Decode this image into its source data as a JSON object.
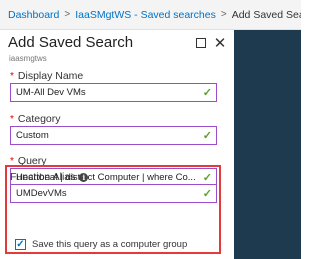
{
  "breadcrumb": {
    "items": [
      "Dashboard",
      "IaaSMgtWS - Saved searches",
      "Add Saved Search"
    ],
    "separator": ">"
  },
  "panel": {
    "title": "Add Saved Search",
    "subtitle": "iaasmgtws",
    "maximize_icon": "maximize-icon",
    "close_icon": "close-icon"
  },
  "form": {
    "display_name": {
      "label": "Display Name",
      "required_mark": "*",
      "value": "UM-All Dev VMs"
    },
    "category": {
      "label": "Category",
      "required_mark": "*",
      "value": "Custom"
    },
    "query": {
      "label": "Query",
      "required_mark": "*",
      "value": "Heartbeat | distinct Computer | where Co..."
    },
    "function_alias": {
      "label": "Function Alias",
      "info_glyph": "i",
      "value": "UMDevVMs"
    },
    "computer_group": {
      "label": "Save this query as a computer group",
      "checked": true
    }
  },
  "glyphs": {
    "check": "✓",
    "close": "✕"
  },
  "colors": {
    "link": "#0072c6",
    "input_border": "#9b4dca",
    "valid_check": "#5aa02c",
    "highlight": "#e23b3b",
    "right_strip": "#1e3a4f"
  }
}
